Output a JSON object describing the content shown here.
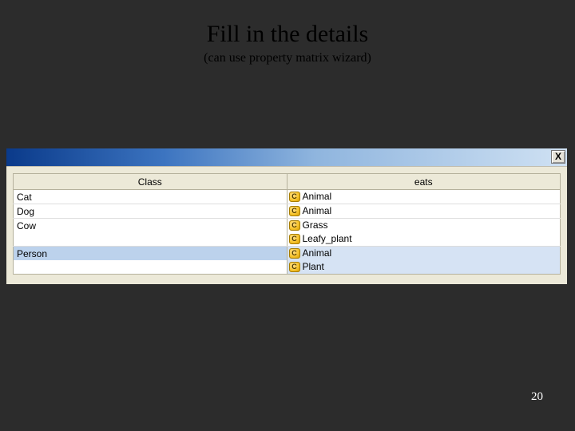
{
  "slide": {
    "title": "Fill in the details",
    "subtitle": "(can use property matrix wizard)",
    "page_number": "20"
  },
  "window": {
    "close_label": "X",
    "columns": {
      "class": "Class",
      "eats": "eats"
    },
    "class_icon_letter": "C",
    "rows": [
      {
        "class_name": "Cat",
        "eats": [
          "Animal"
        ],
        "selected": false
      },
      {
        "class_name": "Dog",
        "eats": [
          "Animal"
        ],
        "selected": false
      },
      {
        "class_name": "Cow",
        "eats": [
          "Grass",
          "Leafy_plant"
        ],
        "selected": false
      },
      {
        "class_name": "Person",
        "eats": [
          "Animal",
          "Plant"
        ],
        "selected": true
      }
    ]
  }
}
